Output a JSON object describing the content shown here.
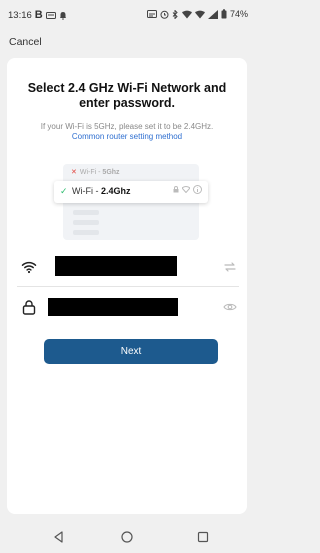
{
  "status_bar": {
    "time": "13:16",
    "b_label": "B",
    "battery": "74%"
  },
  "header": {
    "cancel_label": "Cancel"
  },
  "main": {
    "title": "Select 2.4 GHz Wi-Fi Network and enter password.",
    "subtitle": "If your Wi-Fi is 5GHz, please set it to be 2.4GHz.",
    "link": "Common router setting method"
  },
  "illustration": {
    "bad_prefix": "Wi-Fi - ",
    "bad_band": "5Ghz",
    "good_prefix": "Wi-Fi - ",
    "good_band": "2.4Ghz"
  },
  "form": {
    "ssid_value": "",
    "password_value": ""
  },
  "next_label": "Next",
  "colors": {
    "background": "#f0f0f0",
    "card": "#ffffff",
    "primary_button": "#1d5a8e",
    "link": "#2f6fd0",
    "error_x": "#e2433c",
    "check": "#2dbd6e"
  },
  "icons": [
    "wifi-icon",
    "lock-icon",
    "switch-network-icon",
    "eye-icon",
    "back-nav-icon",
    "home-nav-icon",
    "recents-nav-icon"
  ]
}
